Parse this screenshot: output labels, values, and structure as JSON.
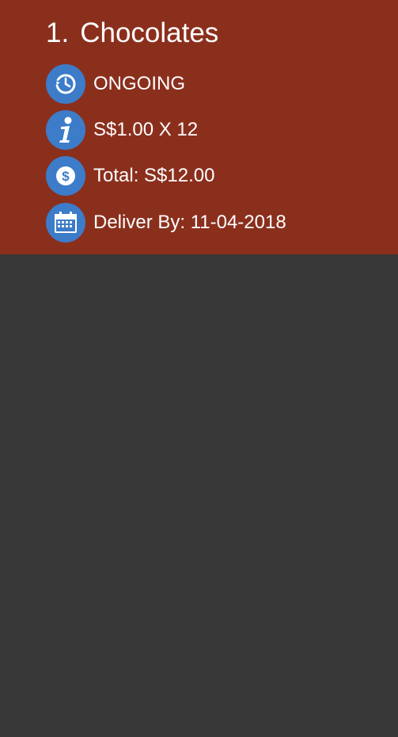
{
  "order": {
    "index": "1.",
    "name": "Chocolates",
    "status": "ONGOING",
    "unit_price_qty": "S$1.00 X 12",
    "total": "Total: S$12.00",
    "deliver_by": "Deliver By: 11-04-2018"
  },
  "icons": {
    "status": "clock-history-icon",
    "info": "info-icon",
    "money": "dollar-coin-icon",
    "calendar": "calendar-icon"
  },
  "colors": {
    "card_background": "#8b2f1d",
    "page_background": "#383838",
    "icon_background": "#3c7cc9",
    "text": "#ffffff"
  }
}
